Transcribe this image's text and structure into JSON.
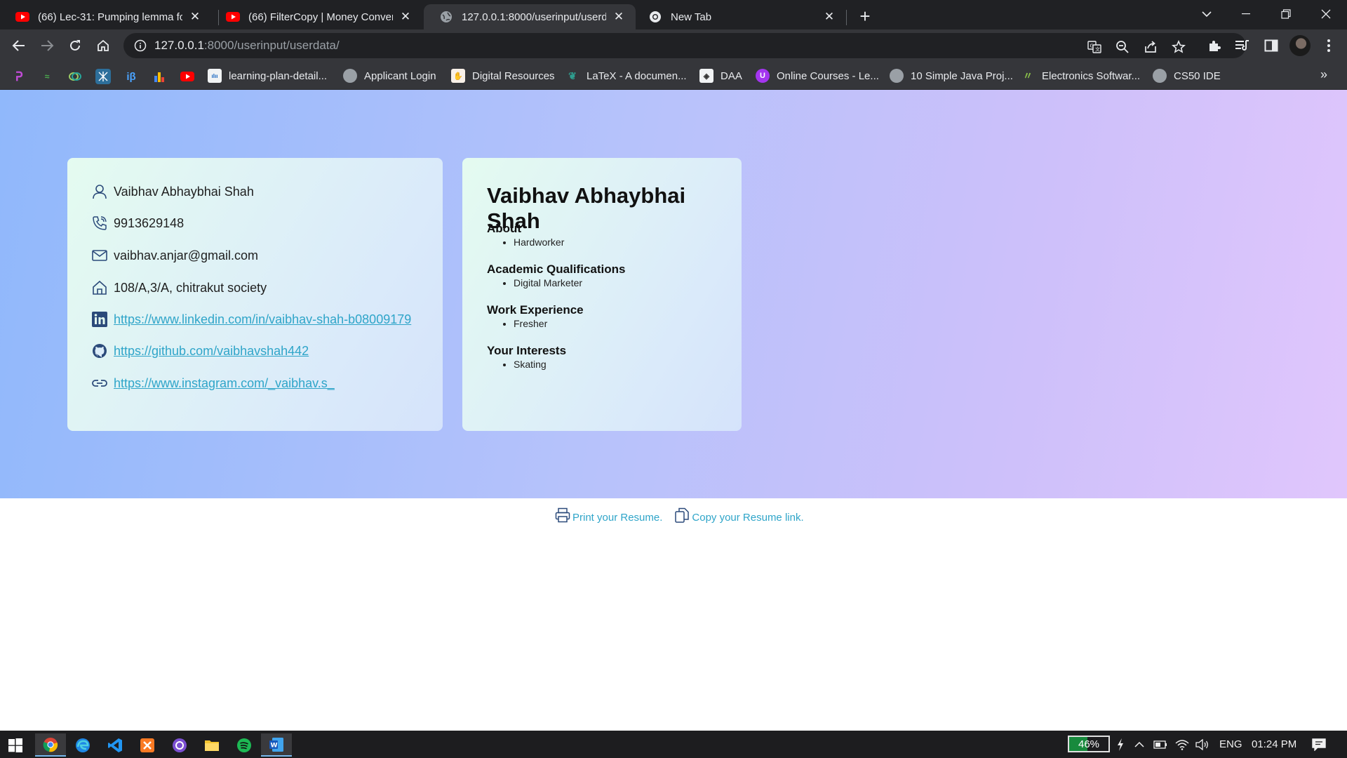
{
  "tabs": [
    {
      "title": "(66) Lec-31: Pumping lemma for regular",
      "icon": "youtube-icon"
    },
    {
      "title": "(66) FilterCopy | Money Conversations",
      "icon": "youtube-icon"
    },
    {
      "title": "127.0.0.1:8000/userinput/userdata/",
      "icon": "globe-icon"
    },
    {
      "title": "New Tab",
      "icon": "chrome-icon"
    }
  ],
  "address_bar": {
    "host": "127.0.0.1",
    "rest": ":8000/userinput/userdata/"
  },
  "bookmarks": [
    {
      "label": "learning-plan-detail...",
      "icon": "cisco-icon"
    },
    {
      "label": "Applicant Login",
      "icon": "globe-icon"
    },
    {
      "label": "Digital Resources",
      "icon": "digital-resources-icon"
    },
    {
      "label": "LaTeX - A documen...",
      "icon": "latex-icon"
    },
    {
      "label": "DAA",
      "icon": "daa-icon"
    },
    {
      "label": "Online Courses - Le...",
      "icon": "udemy-icon"
    },
    {
      "label": "10 Simple Java Proj...",
      "icon": "globe-icon"
    },
    {
      "label": "Electronics Softwar...",
      "icon": "electronics-icon"
    },
    {
      "label": "CS50 IDE",
      "icon": "globe-icon"
    }
  ],
  "contact": {
    "name": "Vaibhav Abhaybhai Shah",
    "phone": "9913629148",
    "email": "vaibhav.anjar@gmail.com",
    "address": "108/A,3/A, chitrakut society",
    "linkedin": "https://www.linkedin.com/in/vaibhav-shah-b08009179",
    "github": "https://github.com/vaibhavshah442",
    "instagram": "https://www.instagram.com/_vaibhav.s_"
  },
  "summary": {
    "name": "Vaibhav Abhaybhai Shah",
    "sections": [
      {
        "heading": "About",
        "item": "Hardworker"
      },
      {
        "heading": "Academic Qualifications",
        "item": "Digital Marketer"
      },
      {
        "heading": "Work Experience",
        "item": "Fresher"
      },
      {
        "heading": "Your Interests",
        "item": "Skating"
      }
    ]
  },
  "actions": {
    "print": "Print your Resume.",
    "copy": "Copy your Resume link."
  },
  "taskbar": {
    "apps": [
      "windows-start-icon",
      "chrome-icon",
      "edge-icon",
      "vscode-icon",
      "xampp-icon",
      "github-desktop-icon",
      "file-explorer-icon",
      "spotify-icon",
      "word-icon"
    ],
    "battery_percent": 46,
    "battery_label": "46%",
    "language": "ENG",
    "time": "01:24 PM"
  },
  "colors": {
    "link": "#2fa5c9",
    "chrome_dark": "#202124",
    "chrome_toolbar": "#35363a"
  }
}
